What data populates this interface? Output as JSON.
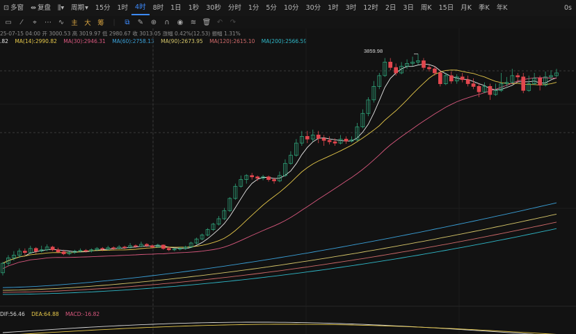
{
  "toolbar": {
    "items": [
      "多窗",
      "复盘",
      "周期",
      "15分",
      "1时",
      "4时",
      "8时",
      "1日",
      "1秒",
      "30秒",
      "分时",
      "1分",
      "5分",
      "10分",
      "30分",
      "1时",
      "3时",
      "12时",
      "2日",
      "3日",
      "周K",
      "15日",
      "月K",
      "季K",
      "年K"
    ],
    "active": "4时",
    "right_label": "0s"
  },
  "drawtools": {
    "gold": [
      "主",
      "大",
      "筹"
    ]
  },
  "info": {
    "date": "25-07-15 04:00",
    "open_label": "开",
    "open": "3000.53",
    "high_label": "高",
    "high": "3019.97",
    "low_label": "低",
    "low": "2980.67",
    "close_label": "收",
    "close": "3013.05",
    "change_label": "涨幅",
    "change": "0.42%(12.53)",
    "amp_label": "振幅",
    "amp": "1.31%"
  },
  "ma_legend": [
    {
      "text": ".82",
      "color": "#e8e8e8"
    },
    {
      "text": "MA(14):2990.82",
      "color": "#e6c84a"
    },
    {
      "text": "MA(30):2946.31",
      "color": "#d9587e"
    },
    {
      "text": "MA(60):2758.13",
      "color": "#3aa0d8"
    },
    {
      "text": "MA(90):2673.95",
      "color": "#d7c76a"
    },
    {
      "text": "MA(120):2615.10",
      "color": "#d06a6a"
    },
    {
      "text": "MA(200):2566.59",
      "color": "#2fb8c8"
    }
  ],
  "macd_legend": [
    {
      "text": "DIF:56.46",
      "color": "#d8d8d8"
    },
    {
      "text": "DEA:64.88",
      "color": "#e6c84a"
    },
    {
      "text": "MACD:-16.82",
      "color": "#d9587e"
    }
  ],
  "chart_data": {
    "type": "candlestick",
    "high_marker": "3859.98",
    "up_color": "#2fa37a",
    "down_color": "#e2474e",
    "candles": [
      [
        2240,
        2310,
        2220,
        2320
      ],
      [
        2310,
        2350,
        2290,
        2370
      ],
      [
        2350,
        2370,
        2330,
        2400
      ],
      [
        2370,
        2400,
        2350,
        2420
      ],
      [
        2400,
        2390,
        2370,
        2420
      ],
      [
        2390,
        2420,
        2380,
        2440
      ],
      [
        2420,
        2400,
        2380,
        2430
      ],
      [
        2400,
        2410,
        2390,
        2440
      ],
      [
        2410,
        2430,
        2400,
        2450
      ],
      [
        2430,
        2410,
        2400,
        2440
      ],
      [
        2410,
        2395,
        2385,
        2425
      ],
      [
        2395,
        2380,
        2370,
        2410
      ],
      [
        2380,
        2390,
        2370,
        2400
      ],
      [
        2390,
        2400,
        2380,
        2410
      ],
      [
        2400,
        2405,
        2390,
        2420
      ],
      [
        2405,
        2400,
        2390,
        2415
      ],
      [
        2400,
        2410,
        2390,
        2420
      ],
      [
        2410,
        2420,
        2400,
        2430
      ],
      [
        2420,
        2415,
        2400,
        2430
      ],
      [
        2415,
        2425,
        2405,
        2440
      ],
      [
        2425,
        2420,
        2410,
        2435
      ],
      [
        2420,
        2430,
        2415,
        2445
      ],
      [
        2430,
        2425,
        2415,
        2440
      ],
      [
        2425,
        2440,
        2420,
        2460
      ],
      [
        2440,
        2435,
        2425,
        2450
      ],
      [
        2435,
        2450,
        2430,
        2470
      ],
      [
        2450,
        2440,
        2430,
        2460
      ],
      [
        2440,
        2430,
        2420,
        2450
      ],
      [
        2430,
        2445,
        2425,
        2455
      ],
      [
        2445,
        2420,
        2410,
        2450
      ],
      [
        2420,
        2410,
        2400,
        2435
      ],
      [
        2410,
        2415,
        2400,
        2425
      ],
      [
        2415,
        2420,
        2405,
        2430
      ],
      [
        2420,
        2430,
        2410,
        2440
      ],
      [
        2430,
        2460,
        2425,
        2470
      ],
      [
        2460,
        2490,
        2450,
        2500
      ],
      [
        2490,
        2520,
        2480,
        2530
      ],
      [
        2520,
        2560,
        2510,
        2570
      ],
      [
        2560,
        2600,
        2550,
        2610
      ],
      [
        2600,
        2640,
        2590,
        2660
      ],
      [
        2640,
        2700,
        2630,
        2720
      ],
      [
        2700,
        2790,
        2690,
        2800
      ],
      [
        2790,
        2880,
        2780,
        2900
      ],
      [
        2880,
        2930,
        2870,
        2960
      ],
      [
        2930,
        2960,
        2900,
        2970
      ],
      [
        2960,
        2950,
        2930,
        2980
      ],
      [
        2950,
        2940,
        2920,
        2960
      ],
      [
        2940,
        2950,
        2925,
        2965
      ],
      [
        2950,
        2930,
        2915,
        2960
      ],
      [
        2930,
        2920,
        2900,
        2945
      ],
      [
        2920,
        2960,
        2910,
        2990
      ],
      [
        2960,
        3050,
        2950,
        3080
      ],
      [
        3050,
        3110,
        3040,
        3140
      ],
      [
        3110,
        3200,
        3100,
        3230
      ],
      [
        3200,
        3250,
        3180,
        3290
      ],
      [
        3250,
        3230,
        3200,
        3290
      ],
      [
        3230,
        3260,
        3210,
        3300
      ],
      [
        3260,
        3235,
        3200,
        3290
      ],
      [
        3235,
        3220,
        3180,
        3260
      ],
      [
        3220,
        3210,
        3190,
        3250
      ],
      [
        3210,
        3200,
        3180,
        3235
      ],
      [
        3200,
        3230,
        3190,
        3260
      ],
      [
        3230,
        3215,
        3195,
        3250
      ],
      [
        3215,
        3225,
        3205,
        3250
      ],
      [
        3225,
        3320,
        3215,
        3350
      ],
      [
        3320,
        3420,
        3310,
        3450
      ],
      [
        3420,
        3520,
        3400,
        3540
      ],
      [
        3520,
        3620,
        3500,
        3660
      ],
      [
        3620,
        3700,
        3600,
        3720
      ],
      [
        3700,
        3800,
        3690,
        3830
      ],
      [
        3800,
        3760,
        3740,
        3830
      ],
      [
        3760,
        3720,
        3700,
        3790
      ],
      [
        3720,
        3770,
        3710,
        3800
      ],
      [
        3770,
        3790,
        3750,
        3820
      ],
      [
        3790,
        3800,
        3770,
        3840
      ],
      [
        3800,
        3810,
        3780,
        3860
      ],
      [
        3810,
        3760,
        3740,
        3830
      ],
      [
        3760,
        3750,
        3730,
        3780
      ],
      [
        3750,
        3720,
        3700,
        3770
      ],
      [
        3720,
        3640,
        3620,
        3740
      ],
      [
        3640,
        3700,
        3630,
        3720
      ],
      [
        3700,
        3660,
        3640,
        3730
      ],
      [
        3660,
        3690,
        3640,
        3710
      ],
      [
        3690,
        3670,
        3650,
        3720
      ],
      [
        3670,
        3640,
        3620,
        3700
      ],
      [
        3640,
        3620,
        3600,
        3680
      ],
      [
        3620,
        3580,
        3540,
        3640
      ],
      [
        3580,
        3620,
        3570,
        3650
      ],
      [
        3620,
        3560,
        3520,
        3640
      ],
      [
        3560,
        3590,
        3550,
        3640
      ],
      [
        3590,
        3640,
        3580,
        3720
      ],
      [
        3640,
        3650,
        3620,
        3690
      ],
      [
        3650,
        3700,
        3640,
        3750
      ],
      [
        3700,
        3690,
        3650,
        3720
      ],
      [
        3690,
        3590,
        3570,
        3720
      ],
      [
        3590,
        3640,
        3580,
        3700
      ],
      [
        3640,
        3680,
        3630,
        3720
      ],
      [
        3680,
        3630,
        3590,
        3700
      ],
      [
        3630,
        3690,
        3620,
        3730
      ],
      [
        3690,
        3700,
        3670,
        3740
      ],
      [
        3700,
        3720,
        3690,
        3750
      ]
    ]
  }
}
